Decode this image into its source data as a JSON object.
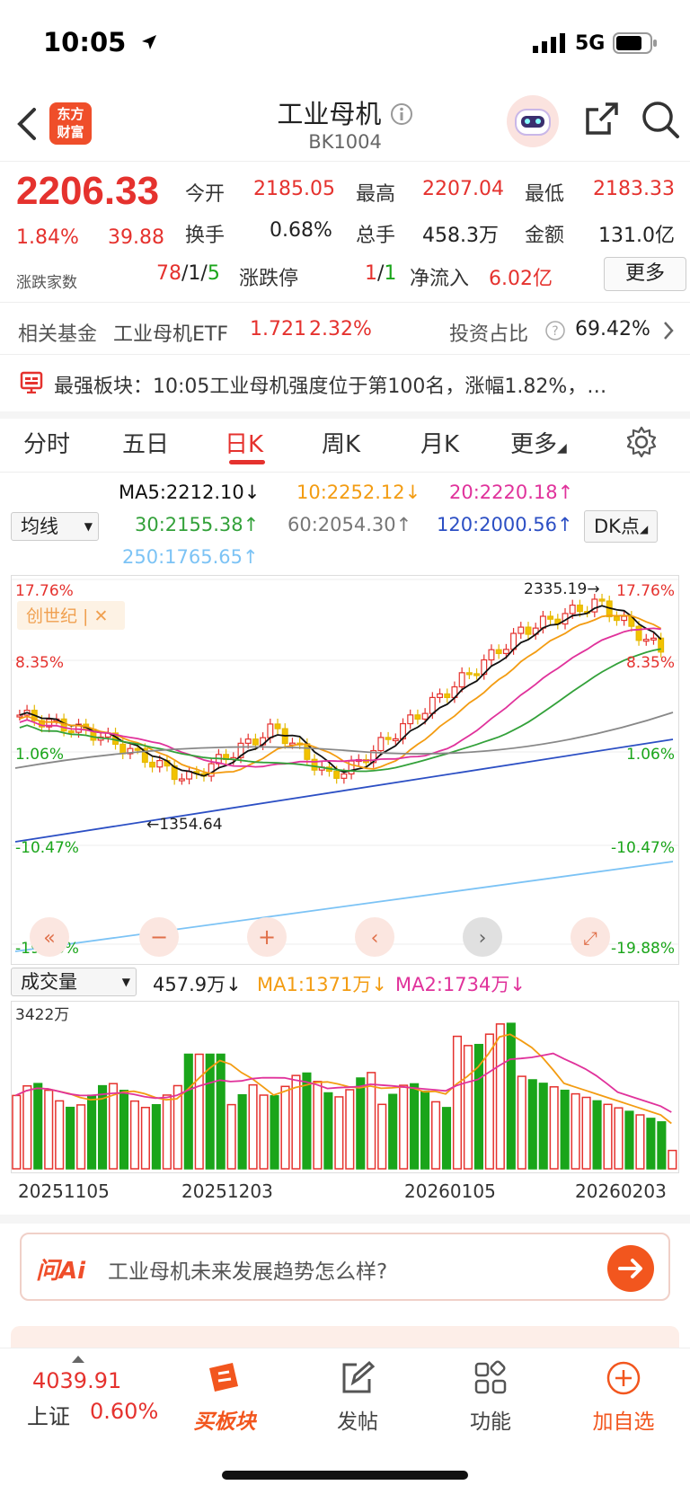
{
  "status_bar": {
    "time": "10:05",
    "network": "5G"
  },
  "header": {
    "logo_line1": "东方",
    "logo_line2": "财富",
    "title": "工业母机",
    "code": "BK1004"
  },
  "quote": {
    "price": "2206.33",
    "change_pct": "1.84%",
    "change": "39.88",
    "open_label": "今开",
    "open": "2185.05",
    "high_label": "最高",
    "high": "2207.04",
    "low_label": "最低",
    "low": "2183.33",
    "turnover_label": "换手",
    "turnover": "0.68%",
    "volume_label": "总手",
    "volume": "458.3万",
    "amount_label": "金额",
    "amount": "131.0亿",
    "breadth_label": "涨跌家数",
    "up_count": "78",
    "flat_count": "1",
    "down_count": "5",
    "limit_label": "涨跌停",
    "limit_up": "1",
    "limit_down": "1",
    "inflow_label": "净流入",
    "inflow": "6.02亿",
    "more_label": "更多"
  },
  "fund": {
    "label": "相关基金",
    "name": "工业母机ETF",
    "price": "1.721",
    "pct": "2.32%",
    "ratio_label": "投资占比",
    "ratio": "69.42%"
  },
  "news": {
    "text": "最强板块：10:05工业母机强度位于第100名，涨幅1.82%，…"
  },
  "tabs": [
    {
      "label": "分时"
    },
    {
      "label": "五日"
    },
    {
      "label": "日K"
    },
    {
      "label": "周K"
    },
    {
      "label": "月K"
    },
    {
      "label": "更多"
    }
  ],
  "ma": {
    "selector": "均线",
    "ma5": "MA5:2212.10",
    "ma10": "10:2252.12",
    "ma20": "20:2220.18",
    "ma30": "30:2155.38",
    "ma60": "60:2054.30",
    "ma120": "120:2000.56",
    "ma250": "250:1765.65",
    "dk": "DK点"
  },
  "chart": {
    "pct_top": "17.76%",
    "pct_mid_up": "8.35%",
    "pct_zero": "1.06%",
    "pct_mid_down": "-10.47%",
    "pct_bottom": "-19.88%",
    "high_label": "2335.19",
    "low_label": "1354.64",
    "tag": "创世纪",
    "colors": {
      "up": "#e5322e",
      "down": "#1aa51a",
      "ma5": "#111111",
      "ma10": "#f39c12",
      "ma20": "#e0329b",
      "ma30": "#33a13a",
      "ma60": "#888888",
      "ma120": "#2c4fc4",
      "ma250": "#7cc3f5"
    }
  },
  "volume": {
    "selector": "成交量",
    "current": "457.9万",
    "ma1": "MA1:1371万",
    "ma2": "MA2:1734万",
    "max_label": "3422万",
    "dates": [
      "20251105",
      "20251203",
      "20260105",
      "20260203"
    ]
  },
  "ai": {
    "brand": "问Ai",
    "placeholder": "工业母机未来发展趋势怎么样?"
  },
  "bottom_nav": {
    "index_value": "4039.91",
    "index_name": "上证",
    "index_pct": "0.60%",
    "buy": "买板块",
    "post": "发帖",
    "func": "功能",
    "add": "加自选"
  },
  "chart_data": {
    "type": "candlestick",
    "y_range_pct": [
      -19.88,
      17.76
    ],
    "volume_max": "3422万",
    "x_ticks": [
      "20251105",
      "20251203",
      "20260105",
      "20260203"
    ]
  }
}
